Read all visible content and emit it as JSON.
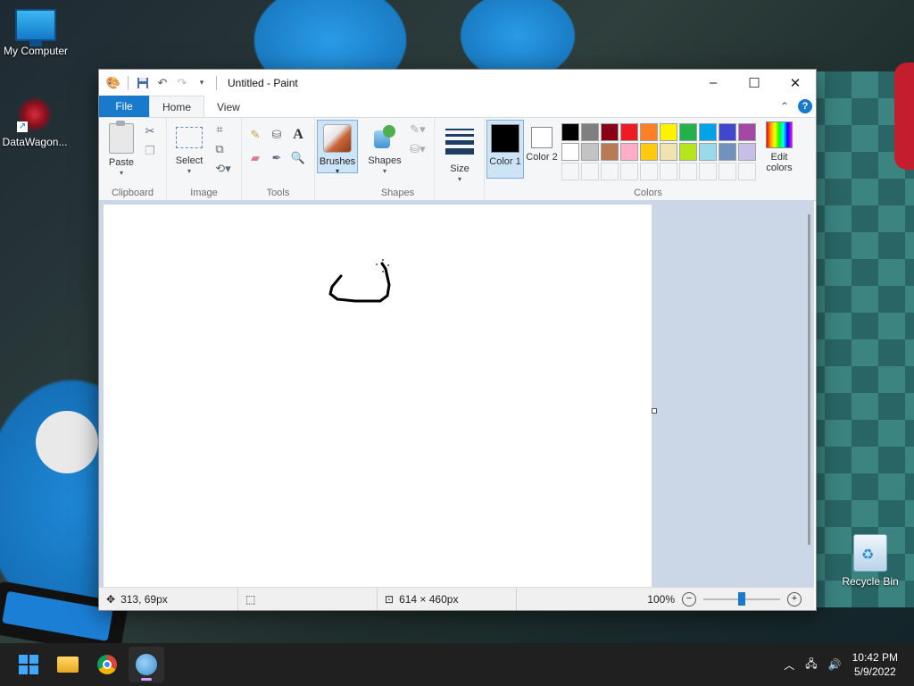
{
  "desktop": {
    "icons": [
      {
        "label": "My Computer",
        "icon": "monitor-icon"
      },
      {
        "label": "DataWagon...",
        "icon": "datawagon-icon"
      },
      {
        "label": "Recycle Bin",
        "icon": "recycle-bin-icon"
      }
    ]
  },
  "window": {
    "title": "Untitled - Paint",
    "controls": {
      "minimize": "–",
      "maximize": "☐",
      "close": "✕"
    }
  },
  "tabs": {
    "file": "File",
    "home": "Home",
    "view": "View"
  },
  "ribbon": {
    "clipboard": {
      "paste": "Paste",
      "group": "Clipboard"
    },
    "image": {
      "select": "Select",
      "group": "Image"
    },
    "tools": {
      "group": "Tools",
      "text_glyph": "A"
    },
    "brushes": {
      "label": "Brushes"
    },
    "shapes": {
      "label": "Shapes",
      "group": "Shapes"
    },
    "size": {
      "label": "Size"
    },
    "colors": {
      "color1": "Color 1",
      "color2": "Color 2",
      "edit": "Edit colors",
      "group": "Colors",
      "color1_value": "#000000",
      "color2_value": "#ffffff",
      "palette": [
        "#000000",
        "#7f7f7f",
        "#880015",
        "#ed1c24",
        "#ff7f27",
        "#fff200",
        "#22b14c",
        "#00a2e8",
        "#3f48cc",
        "#a349a4",
        "#ffffff",
        "#c3c3c3",
        "#b97a57",
        "#ffaec9",
        "#ffc90e",
        "#efe4b0",
        "#b5e61d",
        "#99d9ea",
        "#7092be",
        "#c8bfe7",
        "",
        "",
        "",
        "",
        "",
        "",
        "",
        "",
        "",
        ""
      ]
    }
  },
  "status": {
    "cursor_pos": "313, 69px",
    "canvas_size": "614 × 460px",
    "zoom": "100%"
  },
  "taskbar": {
    "time": "10:42 PM",
    "date": "5/9/2022"
  }
}
